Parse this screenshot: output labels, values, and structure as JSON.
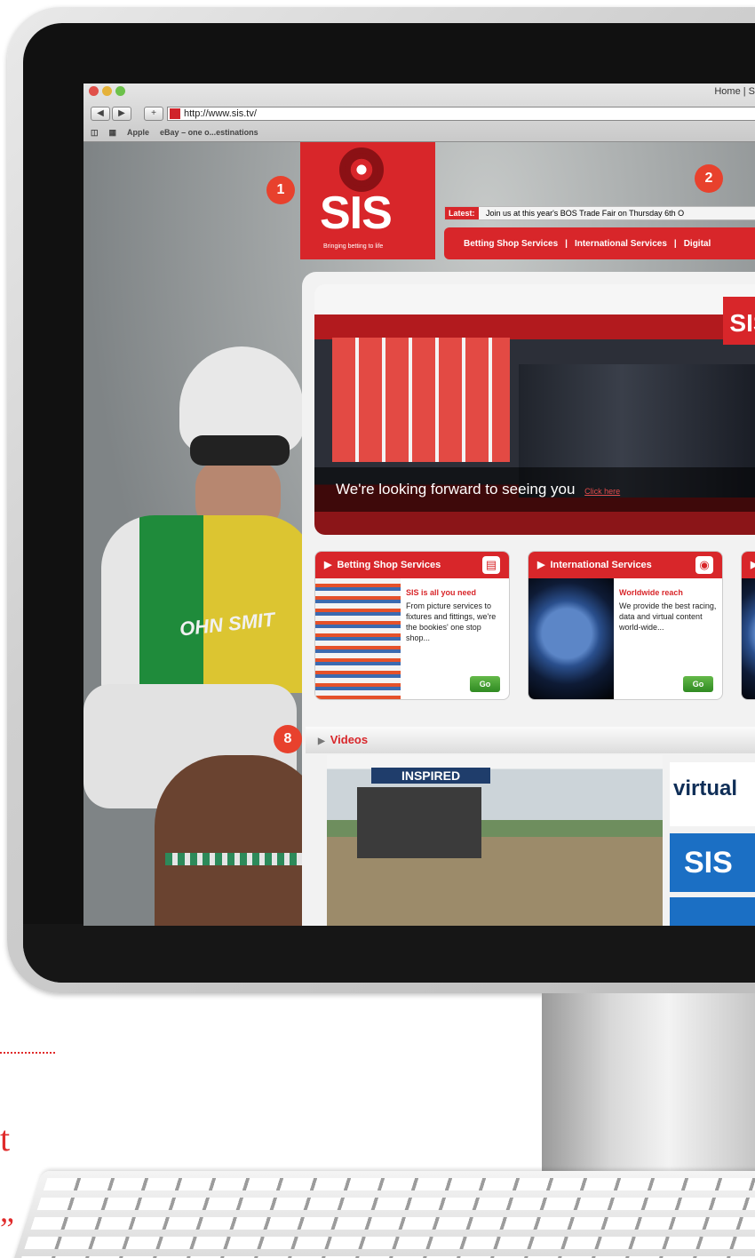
{
  "browser": {
    "top_links": "Home | S",
    "url": "http://www.sis.tv/",
    "bookmarks": [
      "Apple",
      "eBay – one o...estinations"
    ]
  },
  "site": {
    "logo_text": "SIS",
    "tagline": "Bringing betting to life",
    "latest_label": "Latest:",
    "latest_text": "Join us at this year's BOS Trade Fair on Thursday 6th O",
    "nav": [
      "Betting Shop Services",
      "International Services",
      "Digital"
    ],
    "hero_caption": "We're looking forward to seeing you",
    "hero_link": "Click here",
    "hero_logo": "SIS",
    "cards": [
      {
        "heading": "Betting Shop Services",
        "title": "SIS is all you need",
        "body": "From picture services to fixtures and fittings, we're the bookies' one stop shop...",
        "button": "Go"
      },
      {
        "heading": "International Services",
        "title": "Worldwide reach",
        "body": "We provide the best racing, data and virtual content world-wide...",
        "button": "Go"
      }
    ],
    "videos_heading": "Videos",
    "video_banner": "INSPIRED",
    "video_thumbs": [
      "virtual",
      "SIS"
    ],
    "jockey_silks_text": "OHN SMIT"
  },
  "callouts": [
    "1",
    "2",
    "8"
  ],
  "page_fragments": {
    "t": "t",
    "quote": "”"
  },
  "colors": {
    "brand_red": "#d8262a",
    "callout_red": "#e8412d",
    "go_green": "#4aa43a"
  }
}
